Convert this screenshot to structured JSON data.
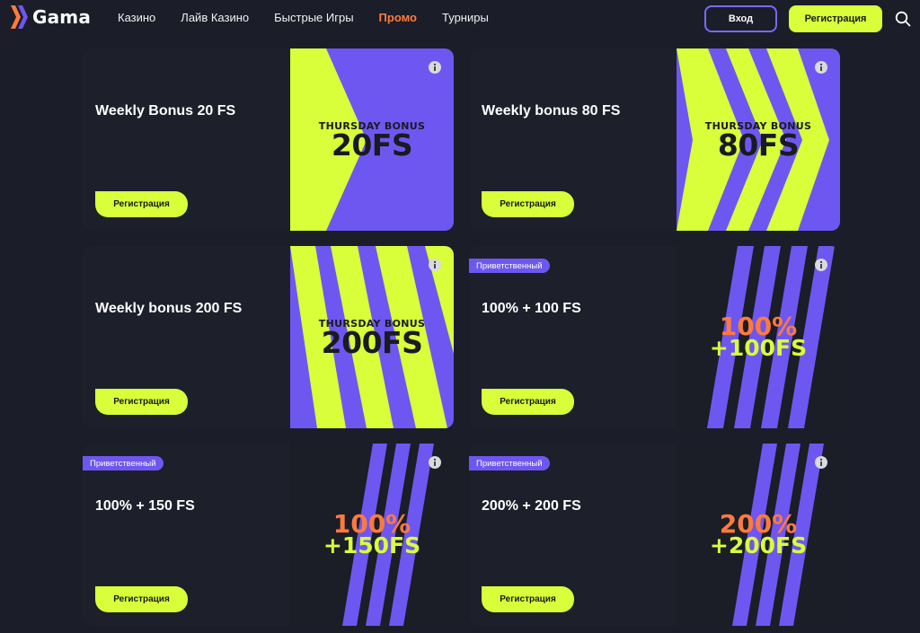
{
  "header": {
    "logo_text": "Gama",
    "nav": [
      "Казино",
      "Лайв Казино",
      "Быстрые Игры",
      "Промо",
      "Турниры"
    ],
    "login_label": "Вход",
    "register_label": "Регистрация"
  },
  "colors": {
    "accent_lime": "#d8ff3a",
    "accent_purple": "#6e57f0",
    "accent_orange": "#ff7a3d",
    "background": "#1b1d29"
  },
  "cards": [
    {
      "title": "Weekly Bonus 20 FS",
      "badge": "",
      "button": "Регистрация",
      "art_line1": "THURSDAY BONUS",
      "art_line2": "20FS"
    },
    {
      "title": "Weekly bonus 80 FS",
      "badge": "",
      "button": "Регистрация",
      "art_line1": "THURSDAY BONUS",
      "art_line2": "80FS"
    },
    {
      "title": "Weekly bonus 200 FS",
      "badge": "",
      "button": "Регистрация",
      "art_line1": "THURSDAY BONUS",
      "art_line2": "200FS"
    },
    {
      "title": "100% + 100 FS",
      "badge": "Приветственный",
      "button": "Регистрация",
      "art_line1": "100%",
      "art_line2": "+100FS"
    },
    {
      "title": "100% + 150 FS",
      "badge": "Приветственный",
      "button": "Регистрация",
      "art_line1": "100%",
      "art_line2": "+150FS"
    },
    {
      "title": "200% + 200 FS",
      "badge": "Приветственный",
      "button": "Регистрация",
      "art_line1": "200%",
      "art_line2": "+200FS"
    }
  ]
}
